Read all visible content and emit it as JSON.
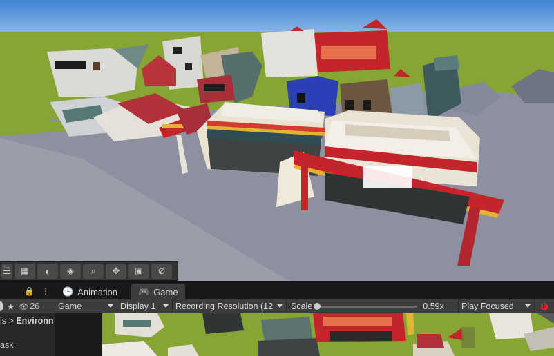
{
  "scene": {
    "toolbar_icons": [
      "scene-list-icon",
      "grid-icon",
      "lighting-icon",
      "layers-icon",
      "search-icon",
      "move-tool-icon",
      "camera-icon",
      "gizmo-icon"
    ]
  },
  "tabs": {
    "lock_icon": "🔒",
    "more_icon": "⋮",
    "items": [
      {
        "label": "Animation",
        "icon": "clock-icon",
        "glyph": "🕒"
      },
      {
        "label": "Game",
        "icon": "gamepad-icon",
        "glyph": "🎮"
      }
    ]
  },
  "hierarchy": {
    "star_glyph": "★",
    "visibility_glyph": "👁",
    "visible_count": "26",
    "breadcrumb_prefix": "ls",
    "breadcrumb_sep": ">",
    "breadcrumb_current": "Environn",
    "item_label": "ask"
  },
  "game_toolbar": {
    "view_select": "Game",
    "display_select": "Display 1",
    "resolution_select": "Recording Resolution (12",
    "scale_label": "Scale",
    "scale_value": "0.59x",
    "scale_fraction": 0.0,
    "play_mode": "Play Focused",
    "bug_icon": "🐞"
  },
  "colors": {
    "sky": "#4d8fd6",
    "grass": "#86a532",
    "road": "#8a8d9c",
    "accent_red": "#c3252b"
  }
}
